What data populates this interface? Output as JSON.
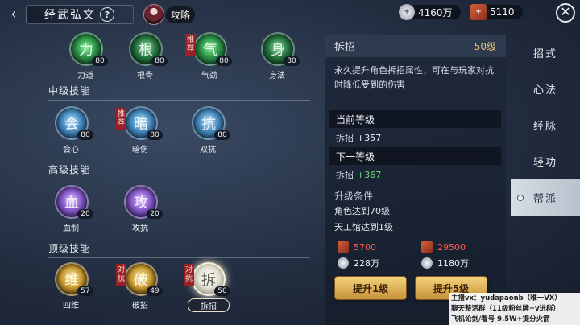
{
  "header": {
    "title": "经武弘文",
    "help": "?",
    "guide_label": "攻略",
    "currency_silver": "4160万",
    "currency_silver_icon": "+",
    "currency_token": "5110",
    "currency_token_icon": "+"
  },
  "sections": {
    "mid": "中级技能",
    "high": "高级技能",
    "top": "顶级技能"
  },
  "skills": {
    "basic": [
      {
        "name": "力道",
        "level": "80",
        "glyph": "力"
      },
      {
        "name": "根骨",
        "level": "80",
        "glyph": "根"
      },
      {
        "name": "气劲",
        "level": "80",
        "glyph": "气",
        "tag": "推荐"
      },
      {
        "name": "身法",
        "level": "80",
        "glyph": "身"
      }
    ],
    "mid": [
      {
        "name": "会心",
        "level": "80",
        "glyph": "会"
      },
      {
        "name": "暗伤",
        "level": "80",
        "glyph": "暗",
        "tag": "推荐"
      },
      {
        "name": "双抗",
        "level": "80",
        "glyph": "抗"
      }
    ],
    "high": [
      {
        "name": "血制",
        "level": "20",
        "glyph": "血"
      },
      {
        "name": "攻抗",
        "level": "20",
        "glyph": "攻"
      }
    ],
    "top": [
      {
        "name": "四维",
        "level": "57",
        "glyph": "维"
      },
      {
        "name": "破招",
        "level": "49",
        "glyph": "破",
        "tag": "对抗"
      },
      {
        "name": "拆招",
        "level": "50",
        "glyph": "拆",
        "tag": "对抗"
      }
    ]
  },
  "detail": {
    "name": "拆招",
    "level": "50级",
    "description": "永久提升角色拆招属性，可在与玩家对抗时降低受到的伤害",
    "current_header": "当前等级",
    "current_stat_label": "拆招",
    "current_stat_value": "+357",
    "next_header": "下一等级",
    "next_stat_label": "拆招",
    "next_stat_value": "+367",
    "req_title": "升级条件",
    "req_1": "角色达到70级",
    "req_2": "天工馆达到1级",
    "cost1_token": "5700",
    "cost1_silver": "228万",
    "cost5_token": "29500",
    "cost5_silver": "1180万",
    "btn_up1": "提升1级",
    "btn_up5": "提升5级"
  },
  "tabs": [
    "招式",
    "心法",
    "经脉",
    "轻功",
    "帮派"
  ],
  "active_tab": "帮派",
  "overlay": {
    "line1": "主播vx：yudapaonb（唯一VX）",
    "line2": "聊天整活群（11级粉丝牌+v进群）",
    "line3": "飞机论剑/看号  9.5W+提分火箭"
  }
}
